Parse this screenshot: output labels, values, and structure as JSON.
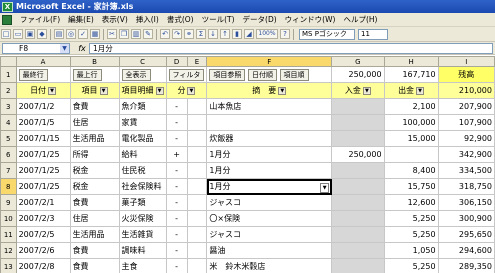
{
  "window": {
    "title": "Microsoft Excel - 家計簿.xls",
    "app_icon": "X"
  },
  "menu": [
    "ファイル(F)",
    "編集(E)",
    "表示(V)",
    "挿入(I)",
    "書式(O)",
    "ツール(T)",
    "データ(D)",
    "ウィンドウ(W)",
    "ヘルプ(H)"
  ],
  "toolbar": {
    "icons": [
      "new-icon",
      "open-icon",
      "save-icon",
      "permission-icon",
      "print-icon",
      "preview-icon",
      "spell-icon",
      "research-icon",
      "cut-icon",
      "copy-icon",
      "paste-icon",
      "format-painter-icon",
      "undo-icon",
      "redo-icon",
      "hyperlink-icon",
      "autosum-icon",
      "sort-asc-icon",
      "sort-desc-icon",
      "chart-icon",
      "drawing-icon",
      "zoom-icon",
      "help-icon"
    ],
    "toolbar_glyphs": {
      "autosum": "Σ",
      "zoom": "100%"
    },
    "font_name": "MS Pゴシック",
    "font_size": "11"
  },
  "formula": {
    "namebox": "F8",
    "fx": "fx",
    "value": "1月分"
  },
  "columns": [
    "A",
    "B",
    "C",
    "D",
    "E",
    "F",
    "G",
    "H",
    "I"
  ],
  "rows": {
    "r1": {
      "buttons": [
        "最終行",
        "最上行",
        "全表示",
        "フィルタ",
        "項目参照",
        "日付順",
        "項目順"
      ],
      "g": "250,000",
      "h": "167,710",
      "i": "残高"
    },
    "r2": {
      "date": "日付",
      "item": "項目",
      "detail": "項目明細",
      "div": "分",
      "memo": "摘　要",
      "income": "入金",
      "expense": "出金",
      "balance": "210,000"
    },
    "data": [
      {
        "n": "3",
        "date": "2007/1/2",
        "item": "食費",
        "detail": "魚介類",
        "div": "-",
        "memo": "山本魚店",
        "income": "",
        "expense": "2,100",
        "balance": "207,900"
      },
      {
        "n": "4",
        "date": "2007/1/5",
        "item": "住居",
        "detail": "家賃",
        "div": "-",
        "memo": "",
        "income": "",
        "expense": "100,000",
        "balance": "107,900"
      },
      {
        "n": "5",
        "date": "2007/1/15",
        "item": "生活用品",
        "detail": "電化製品",
        "div": "-",
        "memo": "炊飯器",
        "income": "",
        "expense": "15,000",
        "balance": "92,900"
      },
      {
        "n": "6",
        "date": "2007/1/25",
        "item": "所得",
        "detail": "給料",
        "div": "+",
        "memo": "1月分",
        "income": "250,000",
        "expense": "",
        "balance": "342,900"
      },
      {
        "n": "7",
        "date": "2007/1/25",
        "item": "税金",
        "detail": "住民税",
        "div": "-",
        "memo": "1月分",
        "income": "",
        "expense": "8,400",
        "balance": "334,500"
      },
      {
        "n": "8",
        "date": "2007/1/25",
        "item": "税金",
        "detail": "社会保険料",
        "div": "-",
        "memo": "1月分",
        "income": "",
        "expense": "15,750",
        "balance": "318,750"
      },
      {
        "n": "9",
        "date": "2007/2/1",
        "item": "食費",
        "detail": "菓子類",
        "div": "-",
        "memo": "ジャスコ",
        "income": "",
        "expense": "12,600",
        "balance": "306,150"
      },
      {
        "n": "10",
        "date": "2007/2/3",
        "item": "住居",
        "detail": "火災保険",
        "div": "-",
        "memo": "〇×保険",
        "income": "",
        "expense": "5,250",
        "balance": "300,900"
      },
      {
        "n": "11",
        "date": "2007/2/5",
        "item": "生活用品",
        "detail": "生活雑貨",
        "div": "-",
        "memo": "ジャスコ",
        "income": "",
        "expense": "5,250",
        "balance": "295,650"
      },
      {
        "n": "12",
        "date": "2007/2/6",
        "item": "食費",
        "detail": "調味料",
        "div": "-",
        "memo": "醤油",
        "income": "",
        "expense": "1,050",
        "balance": "294,600"
      },
      {
        "n": "13",
        "date": "2007/2/8",
        "item": "食費",
        "detail": "主食",
        "div": "-",
        "memo": "米　鈴木米穀店",
        "income": "",
        "expense": "5,250",
        "balance": "289,350"
      }
    ]
  },
  "colors": {
    "title_bar": "#2f62c8",
    "header_row": "#ffff99",
    "balance_header": "#ffff66",
    "gray_cell": "#d7d7d7",
    "active_header": "#f9d86c"
  }
}
